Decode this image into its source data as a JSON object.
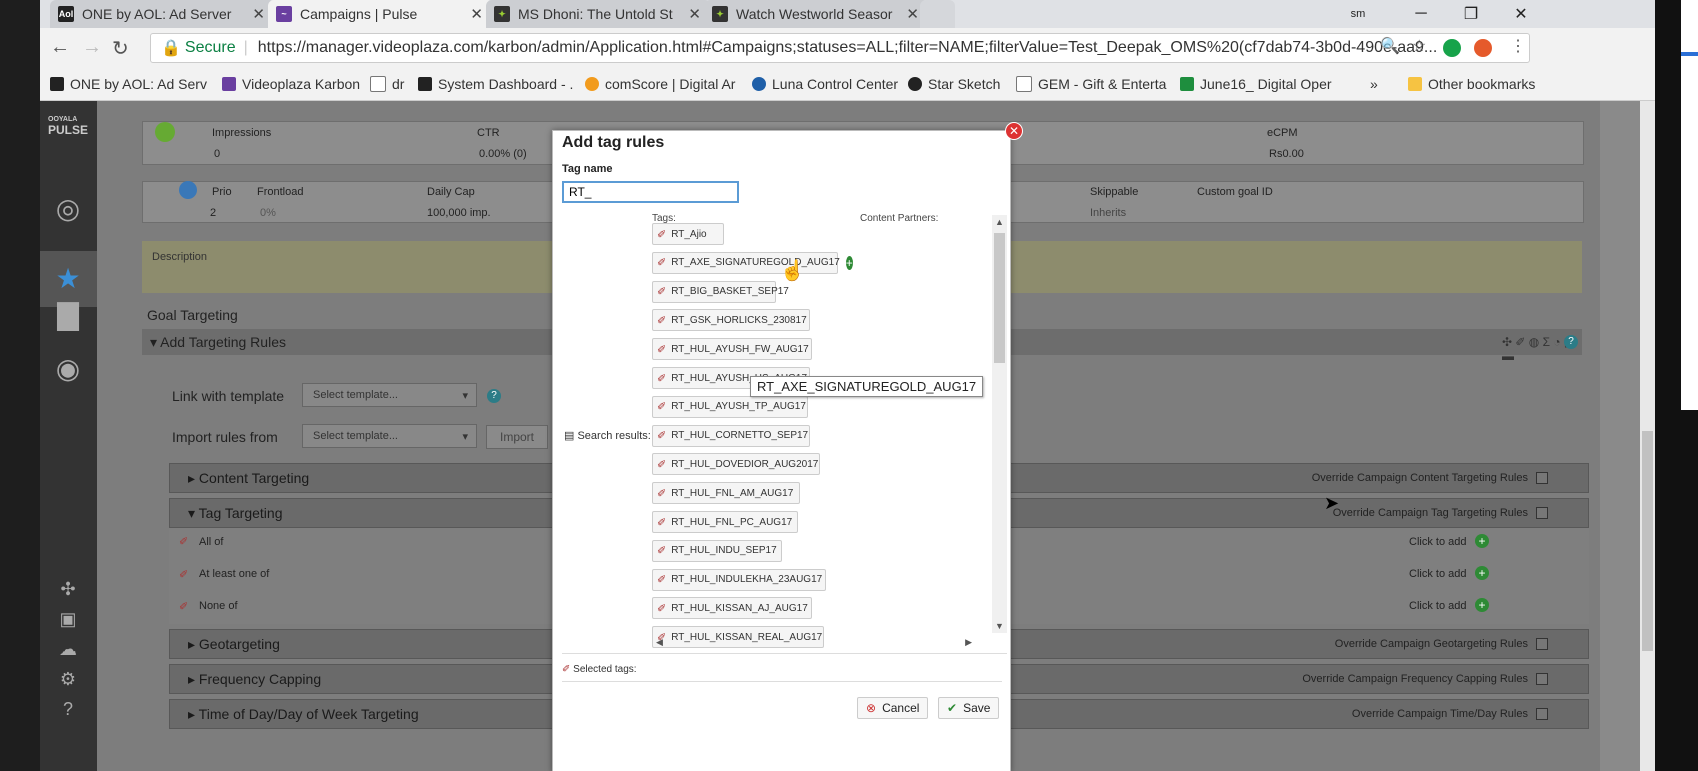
{
  "browser": {
    "tabs": [
      {
        "title": "ONE by AOL: Ad Server",
        "favicon": "AOL",
        "active": false
      },
      {
        "title": "Campaigns | Pulse",
        "favicon": "pulse-icon",
        "active": true
      },
      {
        "title": "MS Dhoni: The Untold St",
        "favicon": "star-sketch-icon",
        "active": false
      },
      {
        "title": "Watch Westworld Seasor",
        "favicon": "star-sketch-icon",
        "active": false
      }
    ],
    "user_badge": "sm",
    "secure_label": "Secure",
    "url": "https://manager.videoplaza.com/karbon/admin/Application.html#Campaigns;statuses=ALL;filter=NAME;filterValue=Test_Deepak_OMS%20(cf7dab74-3b0d-490e-aa9...",
    "bookmarks": [
      "ONE by AOL: Ad Serv",
      "Videoplaza Karbon",
      "dr",
      "System Dashboard - .",
      "comScore | Digital Ar",
      "Luna Control Center",
      "Star Sketch",
      "GEM - Gift & Enterta",
      "June16_ Digital Oper"
    ],
    "more_bookmarks": "»",
    "other_bookmarks": "Other bookmarks"
  },
  "app": {
    "logo_line1": "OOYALA",
    "logo_line2": "PULSE",
    "stats": {
      "headers": [
        "Impressions",
        "CTR",
        "eCPM"
      ],
      "values": [
        "0",
        "0.00% (0)",
        "Rs0.00"
      ]
    },
    "delivery": {
      "headers": [
        "Prio",
        "Frontload",
        "Daily Cap",
        "Skippable",
        "Custom goal ID"
      ],
      "values": [
        "2",
        "0%",
        "100,000 imp.",
        "Inherits",
        ""
      ]
    },
    "description_label": "Description",
    "goal_targeting": "Goal Targeting",
    "add_targeting_rules": "Add Targeting Rules",
    "link_template_label": "Link with template",
    "import_rules_label": "Import rules from",
    "select_placeholder": "Select template...",
    "import_button": "Import",
    "sections": [
      {
        "label": "Content Targeting",
        "override": "Override Campaign Content Targeting Rules",
        "expanded": false
      },
      {
        "label": "Tag Targeting",
        "override": "Override Campaign Tag Targeting Rules",
        "expanded": true
      },
      {
        "label": "Geotargeting",
        "override": "Override Campaign Geotargeting Rules",
        "expanded": false
      },
      {
        "label": "Frequency Capping",
        "override": "Override Campaign Frequency Capping Rules",
        "expanded": false
      },
      {
        "label": "Time of Day/Day of Week Targeting",
        "override": "Override Campaign Time/Day Rules",
        "expanded": false
      }
    ],
    "tag_rows": [
      "All of",
      "At least one of",
      "None of"
    ],
    "click_to_add": "Click to add"
  },
  "modal": {
    "title": "Add tag rules",
    "tag_name_label": "Tag name",
    "tag_name_value": "RT_",
    "tags_header": "Tags:",
    "content_partners_header": "Content Partners:",
    "search_results_label": "Search results:",
    "tags": [
      "RT_Ajio",
      "RT_AXE_SIGNATUREGOLD_AUG17",
      "RT_BIG_BASKET_SEP17",
      "RT_GSK_HORLICKS_230817",
      "RT_HUL_AYUSH_FW_AUG17",
      "RT_HUL_AYUSH_HS_AUG17",
      "RT_HUL_AYUSH_TP_AUG17",
      "RT_HUL_CORNETTO_SEP17",
      "RT_HUL_DOVEDIOR_AUG2017",
      "RT_HUL_FNL_AM_AUG17",
      "RT_HUL_FNL_PC_AUG17",
      "RT_HUL_INDU_SEP17",
      "RT_HUL_INDULEKHA_23AUG17",
      "RT_HUL_KISSAN_AJ_AUG17",
      "RT_HUL_KISSAN_REAL_AUG17"
    ],
    "tooltip": "RT_AXE_SIGNATUREGOLD_AUG17",
    "selected_tags_label": "Selected tags:",
    "cancel_label": "Cancel",
    "save_label": "Save"
  }
}
